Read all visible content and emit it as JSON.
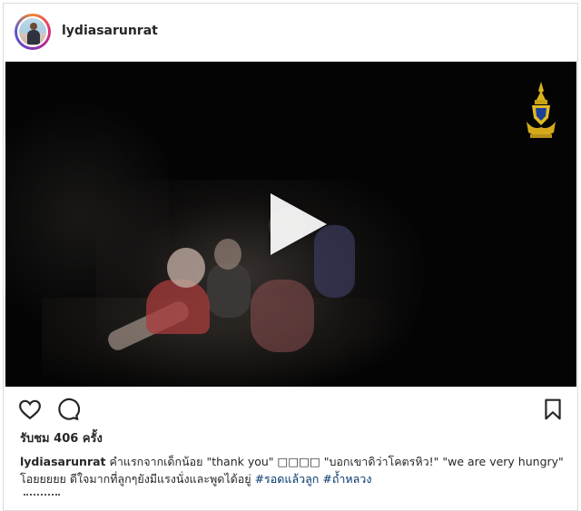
{
  "post": {
    "username": "lydiasarunrat",
    "icons": {
      "avatar": "profile-photo",
      "like": "heart-icon",
      "comment": "speech-bubble-icon",
      "save": "bookmark-icon",
      "play": "play-icon",
      "emblem": "royal-emblem-icon"
    },
    "views_text": "รับชม 406 ครั้ง",
    "caption": {
      "username": "lydiasarunrat",
      "line1_text": "คำแรกจากเด็กน้อย \"thank you\" □□□□ \"บอกเขาดิว่าโคตรหิว!\" \"we are very hungry\"",
      "line2_text": "โอยยยยย ดีใจมากที่ลูกๆยังมีแรงนั่งและพูดได้อยู่",
      "hashtags": [
        "#รอดแล้วลูก",
        "#ถ้ำหลวง"
      ]
    },
    "colors": {
      "text": "#262626",
      "hashtag": "#003569",
      "border": "#dbdbdb",
      "video_bg": "#040404"
    }
  }
}
